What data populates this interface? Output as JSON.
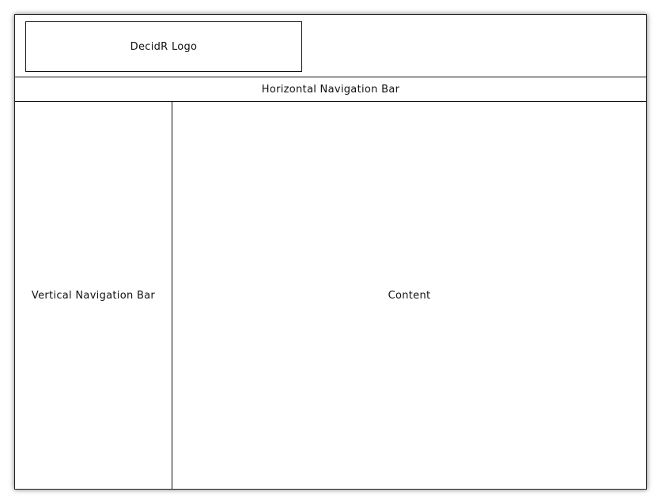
{
  "header": {
    "logo_label": "DecidR Logo"
  },
  "horizontal_nav": {
    "label": "Horizontal Navigation Bar"
  },
  "vertical_nav": {
    "label": "Vertical Navigation Bar"
  },
  "main": {
    "label": "Content"
  },
  "colors": {
    "border": "#111111",
    "background": "#ffffff"
  }
}
